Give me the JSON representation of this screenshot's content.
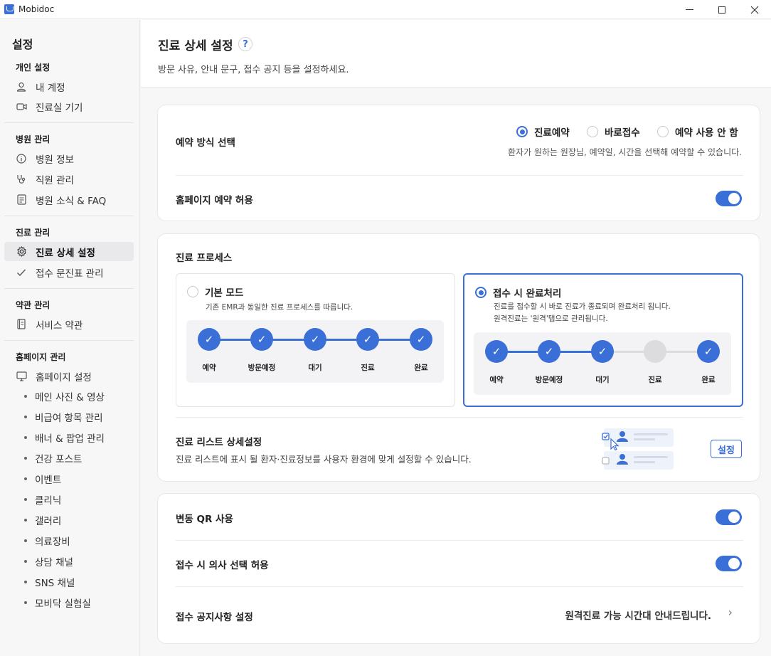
{
  "window": {
    "app_title": "Mobidoc"
  },
  "sidebar": {
    "title": "설정",
    "groups": [
      {
        "label": "개인 설정",
        "items": [
          {
            "label": "내 계정",
            "icon": "user-icon"
          },
          {
            "label": "진료실 기기",
            "icon": "camera-icon"
          }
        ]
      },
      {
        "label": "병원 관리",
        "items": [
          {
            "label": "병원 정보",
            "icon": "info-icon"
          },
          {
            "label": "직원 관리",
            "icon": "stethoscope-icon"
          },
          {
            "label": "병원 소식 & FAQ",
            "icon": "document-icon"
          }
        ]
      },
      {
        "label": "진료 관리",
        "items": [
          {
            "label": "진료 상세 설정",
            "icon": "gear-icon",
            "active": true
          },
          {
            "label": "접수 문진표 관리",
            "icon": "check-icon"
          }
        ]
      },
      {
        "label": "약관 관리",
        "items": [
          {
            "label": "서비스 약관",
            "icon": "book-icon"
          }
        ]
      },
      {
        "label": "홈페이지 관리",
        "items": [
          {
            "label": "홈페이지 설정",
            "icon": "monitor-icon"
          }
        ]
      }
    ],
    "homepage_subitems": [
      "메인 사진 & 영상",
      "비급여 항목 관리",
      "배너 & 팝업 관리",
      "건강 포스트",
      "이벤트",
      "클리닉",
      "갤러리",
      "의료장비",
      "상담 채널",
      "SNS 채널",
      "모비닥 실험실"
    ]
  },
  "header": {
    "title": "진료 상세 설정",
    "help": "?",
    "description": "방문 사유, 안내 문구, 접수 공지 등을 설정하세요."
  },
  "reservation": {
    "label": "예약 방식 선택",
    "options": [
      "진료예약",
      "바로접수",
      "예약 사용 안 함"
    ],
    "selected": "진료예약",
    "helper": "환자가 원하는 원장님, 예약일, 시간을 선택해 예약할 수 있습니다.",
    "homepage_label": "홈페이지 예약 허용",
    "homepage_enabled": true
  },
  "process": {
    "label": "진료 프로세스",
    "modes": [
      {
        "title": "기본 모드",
        "desc": [
          "기존 EMR과 동일한 진료 프로세스를 따릅니다."
        ],
        "selected": false,
        "steps_done": [
          true,
          true,
          true,
          true,
          true
        ]
      },
      {
        "title": "접수 시 완료처리",
        "desc": [
          "진료를 접수할 시 바로 진료가 종료되며 완료처리 됩니다.",
          "원격진료는 '원격'탭으로 관리됩니다."
        ],
        "selected": true,
        "steps_done": [
          true,
          true,
          true,
          false,
          true
        ]
      }
    ],
    "step_labels": [
      "예약",
      "방문예정",
      "대기",
      "진료",
      "완료"
    ],
    "check_glyph": "✓",
    "list_title": "진료 리스트 상세설정",
    "list_desc": "진료 리스트에 표시 될 환자·진료정보를 사용자 환경에 맞게 설정할 수 있습니다.",
    "list_button": "설정"
  },
  "options": {
    "qr_label": "변동 QR 사용",
    "qr_enabled": true,
    "doctor_label": "접수 시 의사 선택 허용",
    "doctor_enabled": true,
    "notice_label": "접수 공지사항 설정",
    "notice_value": "원격진료 가능 시간대 안내드립니다.",
    "chevron": "›"
  },
  "colors": {
    "accent": "#3a6fd8"
  }
}
